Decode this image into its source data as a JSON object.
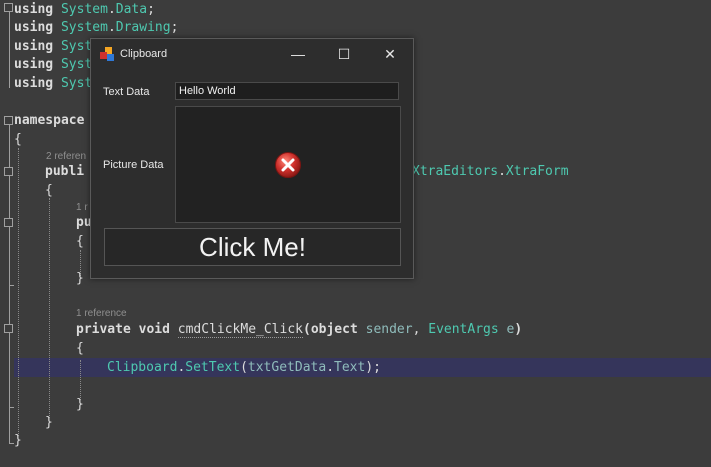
{
  "editor": {
    "using_lines": [
      {
        "kw": "using",
        "ns1": "System",
        "ns2": "Data"
      },
      {
        "kw": "using",
        "ns1": "System",
        "ns2": "Drawing"
      },
      {
        "kw": "using",
        "ns1": "Syst",
        "ns2": ""
      },
      {
        "kw": "using",
        "ns1": "Syst",
        "ns2": ""
      },
      {
        "kw": "using",
        "ns1": "Syst",
        "ns2": ""
      }
    ],
    "namespace_kw": "namespace",
    "open_brace": "{",
    "close_brace": "}",
    "class_refs": "2 referen",
    "class_kw": "publi",
    "class_base_ns": "XtraEditors",
    "class_base_type": "XtraForm",
    "ctor_refs": "1 r",
    "ctor_kw": "pu",
    "method_refs": "1 reference",
    "method": {
      "kw1": "private",
      "kw2": "void",
      "name": "cmdClickMe_Click",
      "open": "(",
      "ptype1": "object",
      "pname1": "sender",
      "comma": ",",
      "ptype2": "EventArgs",
      "pname2": "e",
      "close": ")"
    },
    "statement": {
      "cls": "Clipboard",
      "dot1": ".",
      "fn": "SetText",
      "open": "(",
      "arg": "txtGetData",
      "dot2": ".",
      "prop": "Text",
      "close": ");"
    }
  },
  "window": {
    "title": "Clipboard",
    "minimize_glyph": "—",
    "maximize_glyph": "☐",
    "close_glyph": "✕",
    "text_label": "Text Data",
    "text_value": "Hello World",
    "picture_label": "Picture Data",
    "button_label": "Click Me!",
    "icon_name": "clipboard-app-icon",
    "error_icon_name": "error-icon"
  },
  "colors": {
    "editor_bg": "#3c3c3c",
    "type_color": "#4ec9b0",
    "highlight_row": "#35355b",
    "error_red": "#d0312d"
  }
}
